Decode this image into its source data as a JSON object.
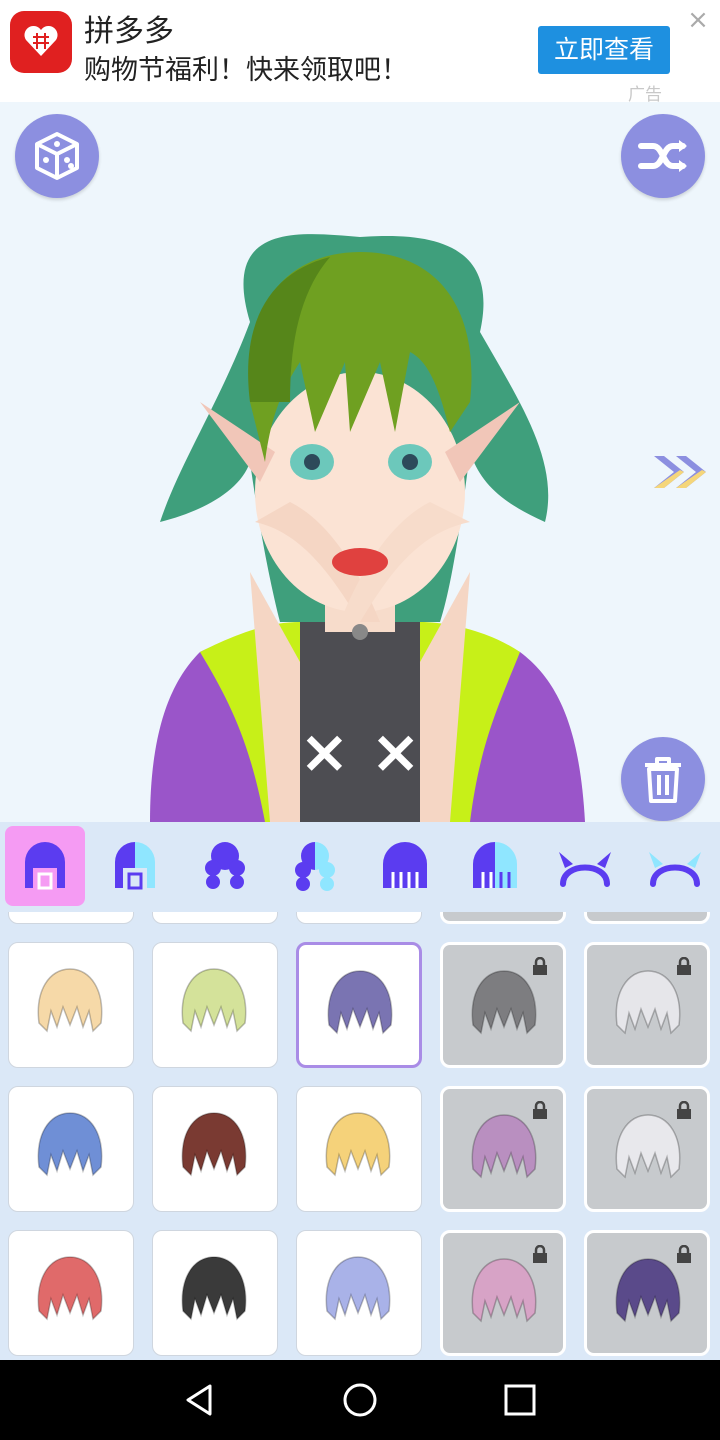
{
  "ad": {
    "app_name": "拼多多",
    "tagline": "购物节福利！快来领取吧！",
    "cta": "立即查看",
    "close": "×",
    "tag": "广告"
  },
  "toolbar": {
    "random_icon": "dice-icon",
    "shuffle_icon": "shuffle-icon",
    "next_icon": "double-chevron-right-icon",
    "delete_icon": "trash-icon"
  },
  "categories": [
    {
      "name": "hair-front",
      "active": true
    },
    {
      "name": "hair-front-color",
      "active": false
    },
    {
      "name": "hair-back",
      "active": false
    },
    {
      "name": "hair-back-color",
      "active": false
    },
    {
      "name": "hair-long",
      "active": false
    },
    {
      "name": "hair-long-color",
      "active": false
    },
    {
      "name": "horns",
      "active": false
    },
    {
      "name": "horns-color",
      "active": false
    }
  ],
  "items": [
    {
      "color": "#f6d9a8",
      "locked": false,
      "selected": false
    },
    {
      "color": "#d4e29a",
      "locked": false,
      "selected": false
    },
    {
      "color": "#7a74b2",
      "locked": false,
      "selected": true
    },
    {
      "color": "#7d7d80",
      "locked": true,
      "selected": false
    },
    {
      "color": "#e6e6ea",
      "locked": true,
      "selected": false
    },
    {
      "color": "#6f8fd6",
      "locked": false,
      "selected": false
    },
    {
      "color": "#7a3a32",
      "locked": false,
      "selected": false
    },
    {
      "color": "#f5d27a",
      "locked": false,
      "selected": false
    },
    {
      "color": "#b98fc0",
      "locked": true,
      "selected": false
    },
    {
      "color": "#e8e8ec",
      "locked": true,
      "selected": false
    },
    {
      "color": "#e06a6a",
      "locked": false,
      "selected": false
    },
    {
      "color": "#3a3a3a",
      "locked": false,
      "selected": false
    },
    {
      "color": "#a9b2e8",
      "locked": false,
      "selected": false
    },
    {
      "color": "#d7a3c6",
      "locked": true,
      "selected": false
    },
    {
      "color": "#5a4a8a",
      "locked": true,
      "selected": false
    }
  ],
  "nav": {
    "back_icon": "back-triangle-icon",
    "home_icon": "home-circle-icon",
    "recents_icon": "recents-square-icon"
  },
  "colors": {
    "accent": "#8c8fe0",
    "tab_active": "#f59bf3",
    "icon_purple": "#5b3cf0",
    "icon_cyan": "#8fe6ff"
  }
}
